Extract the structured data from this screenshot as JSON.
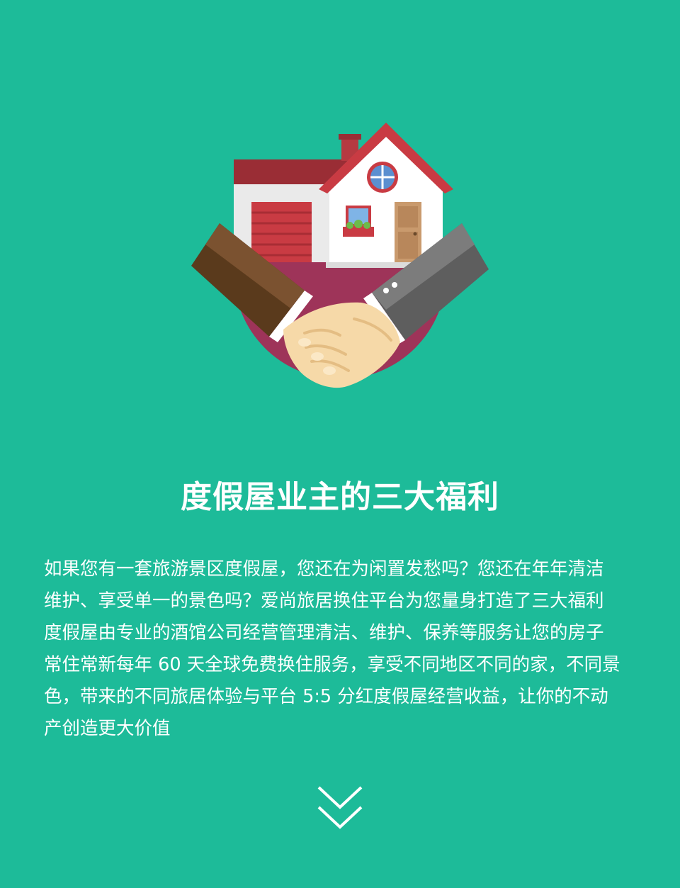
{
  "hero": {
    "icon": "house-handshake-icon"
  },
  "section": {
    "title": "度假屋业主的三大福利",
    "paragraph_lines": [
      "如果您有一套旅游景区度假屋，您还在为闲置发愁吗？您还在年年清洁",
      "维护、享受单一的景色吗？爱尚旅居换住平台为您量身打造了三大福利",
      "度假屋由专业的酒馆公司经营管理清洁、维护、保养等服务让您的房子",
      "常住常新每年 60 天全球免费换住服务，享受不同地区不同的家，不同景",
      "色，带来的不同旅居体验与平台 5:5 分红度假屋经营收益，让你的不动",
      "产创造更大价值"
    ]
  },
  "nav": {
    "scroll_icon": "double-chevron-down-icon"
  },
  "colors": {
    "background": "#1dbb99",
    "text": "#ffffff",
    "roof": "#b53a41",
    "circle": "#9e3459"
  }
}
